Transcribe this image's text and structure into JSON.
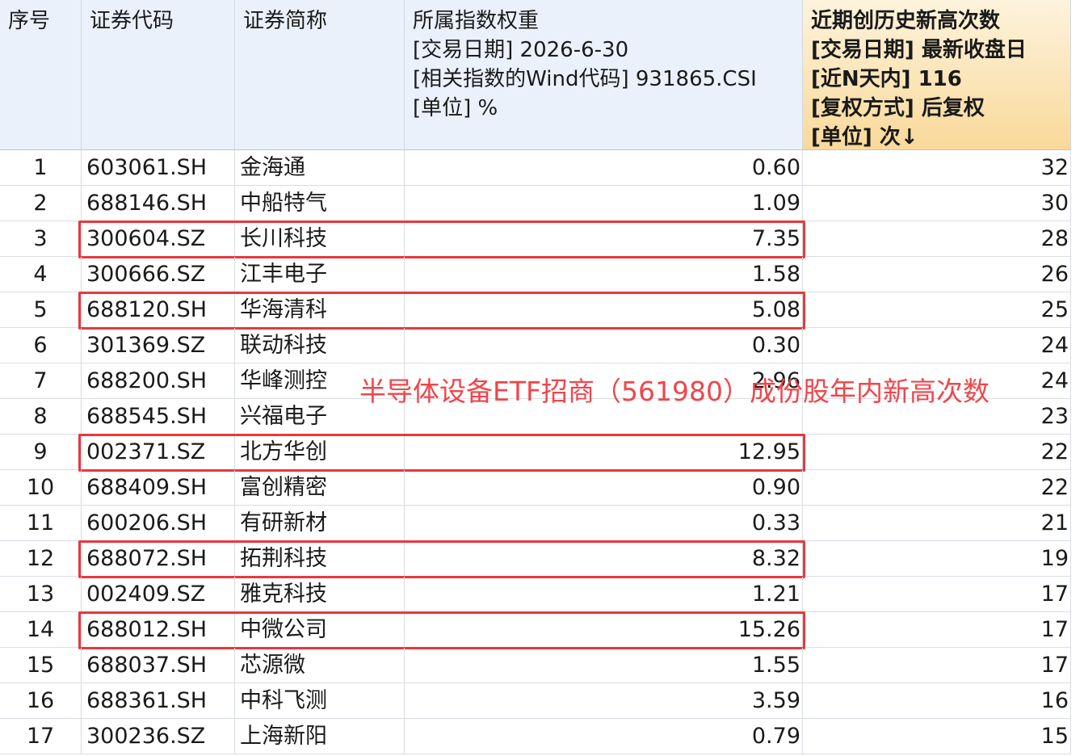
{
  "colors": {
    "header_bg": "#eaf1fb",
    "highlight_header": "#f9d99a",
    "box": "#e8383d",
    "overlay_text": "#f0454a"
  },
  "header": {
    "seq": "序号",
    "code": "证券代码",
    "name": "证券简称",
    "weight": "所属指数权重\n[交易日期] 2026-6-30\n[相关指数的Wind代码] 931865.CSI\n[单位] %",
    "count": "近期创历史新高次数\n[交易日期] 最新收盘日\n[近N天内] 116\n[复权方式] 后复权\n[单位] 次↓"
  },
  "rows": [
    {
      "seq": "1",
      "code": "603061.SH",
      "name": "金海通",
      "weight": "0.60",
      "count": "32"
    },
    {
      "seq": "2",
      "code": "688146.SH",
      "name": "中船特气",
      "weight": "1.09",
      "count": "30"
    },
    {
      "seq": "3",
      "code": "300604.SZ",
      "name": "长川科技",
      "weight": "7.35",
      "count": "28"
    },
    {
      "seq": "4",
      "code": "300666.SZ",
      "name": "江丰电子",
      "weight": "1.58",
      "count": "26"
    },
    {
      "seq": "5",
      "code": "688120.SH",
      "name": "华海清科",
      "weight": "5.08",
      "count": "25"
    },
    {
      "seq": "6",
      "code": "301369.SZ",
      "name": "联动科技",
      "weight": "0.30",
      "count": "24"
    },
    {
      "seq": "7",
      "code": "688200.SH",
      "name": "华峰测控",
      "weight": "2.96",
      "count": "24"
    },
    {
      "seq": "8",
      "code": "688545.SH",
      "name": "兴福电子",
      "weight": "",
      "count": "23"
    },
    {
      "seq": "9",
      "code": "002371.SZ",
      "name": "北方华创",
      "weight": "12.95",
      "count": "22"
    },
    {
      "seq": "10",
      "code": "688409.SH",
      "name": "富创精密",
      "weight": "0.90",
      "count": "22"
    },
    {
      "seq": "11",
      "code": "600206.SH",
      "name": "有研新材",
      "weight": "0.33",
      "count": "21"
    },
    {
      "seq": "12",
      "code": "688072.SH",
      "name": "拓荆科技",
      "weight": "8.32",
      "count": "19"
    },
    {
      "seq": "13",
      "code": "002409.SZ",
      "name": "雅克科技",
      "weight": "1.21",
      "count": "17"
    },
    {
      "seq": "14",
      "code": "688012.SH",
      "name": "中微公司",
      "weight": "15.26",
      "count": "17"
    },
    {
      "seq": "15",
      "code": "688037.SH",
      "name": "芯源微",
      "weight": "1.55",
      "count": "17"
    },
    {
      "seq": "16",
      "code": "688361.SH",
      "name": "中科飞测",
      "weight": "3.59",
      "count": "16"
    },
    {
      "seq": "17",
      "code": "300236.SZ",
      "name": "上海新阳",
      "weight": "0.79",
      "count": "15"
    }
  ],
  "highlighted_rows": [
    "3",
    "5",
    "9",
    "12",
    "14"
  ],
  "overlay": "半导体设备ETF招商（561980）成份股年内新高次数"
}
